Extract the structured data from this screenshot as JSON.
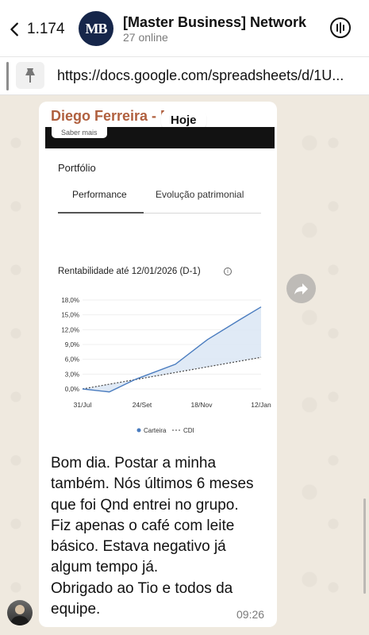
{
  "header": {
    "back_count": "1.174",
    "avatar_initials": "MB",
    "title": "[Master Business] Network",
    "subtitle": "27 online"
  },
  "pinned": {
    "link": "https://docs.google.com/spreadsheets/d/1U..."
  },
  "message": {
    "sender": "Diego Ferreira - M",
    "date_chip": "Hoje",
    "time": "09:26",
    "text_lines": [
      "Bom dia. Postar a minha",
      "também. Nós últimos 6 meses",
      "que foi Qnd entrei no grupo.",
      "Fiz apenas o café com leite",
      "básico. Estava negativo já",
      "algum tempo já.",
      "Obrigado ao Tio e todos da",
      "equipe."
    ]
  },
  "screenshot": {
    "saber_mais": "Saber mais",
    "portfolio_title": "Portfólio",
    "tabs": [
      "Performance",
      "Evolução patrimonial"
    ],
    "active_tab": "Performance",
    "rent_title": "Rentabilidade até 12/01/2026 (D-1)"
  },
  "chart_data": {
    "type": "line",
    "title": "Rentabilidade até 12/01/2026 (D-1)",
    "ytick_labels": [
      "0,0%",
      "3,0%",
      "6,0%",
      "9,0%",
      "12,0%",
      "15,0%",
      "18,0%"
    ],
    "ylim": [
      0,
      18
    ],
    "xtick_labels": [
      "31/Jul",
      "24/Set",
      "18/Nov",
      "12/Jan"
    ],
    "series": [
      {
        "name": "Carteira",
        "style": "solid-area",
        "color": "#4a7cbf",
        "points": [
          [
            0,
            0.0
          ],
          [
            0.15,
            -0.6
          ],
          [
            0.3,
            2.0
          ],
          [
            0.52,
            5.0
          ],
          [
            0.7,
            10.0
          ],
          [
            0.88,
            14.0
          ],
          [
            1.0,
            16.6
          ]
        ]
      },
      {
        "name": "CDI",
        "style": "dashed",
        "color": "#444444",
        "points": [
          [
            0,
            0.0
          ],
          [
            1.0,
            6.4
          ]
        ]
      }
    ],
    "legend": [
      "Carteira",
      "CDI"
    ],
    "legend_position": "bottom"
  },
  "colors": {
    "sender": "#b0603f",
    "header_bg": "#ffffff",
    "bubble_bg": "#ffffff"
  },
  "icons": {
    "back": "chevron-left-icon",
    "call": "group-call-icon",
    "pin": "pin-icon",
    "forward": "forward-icon",
    "info": "info-icon"
  }
}
